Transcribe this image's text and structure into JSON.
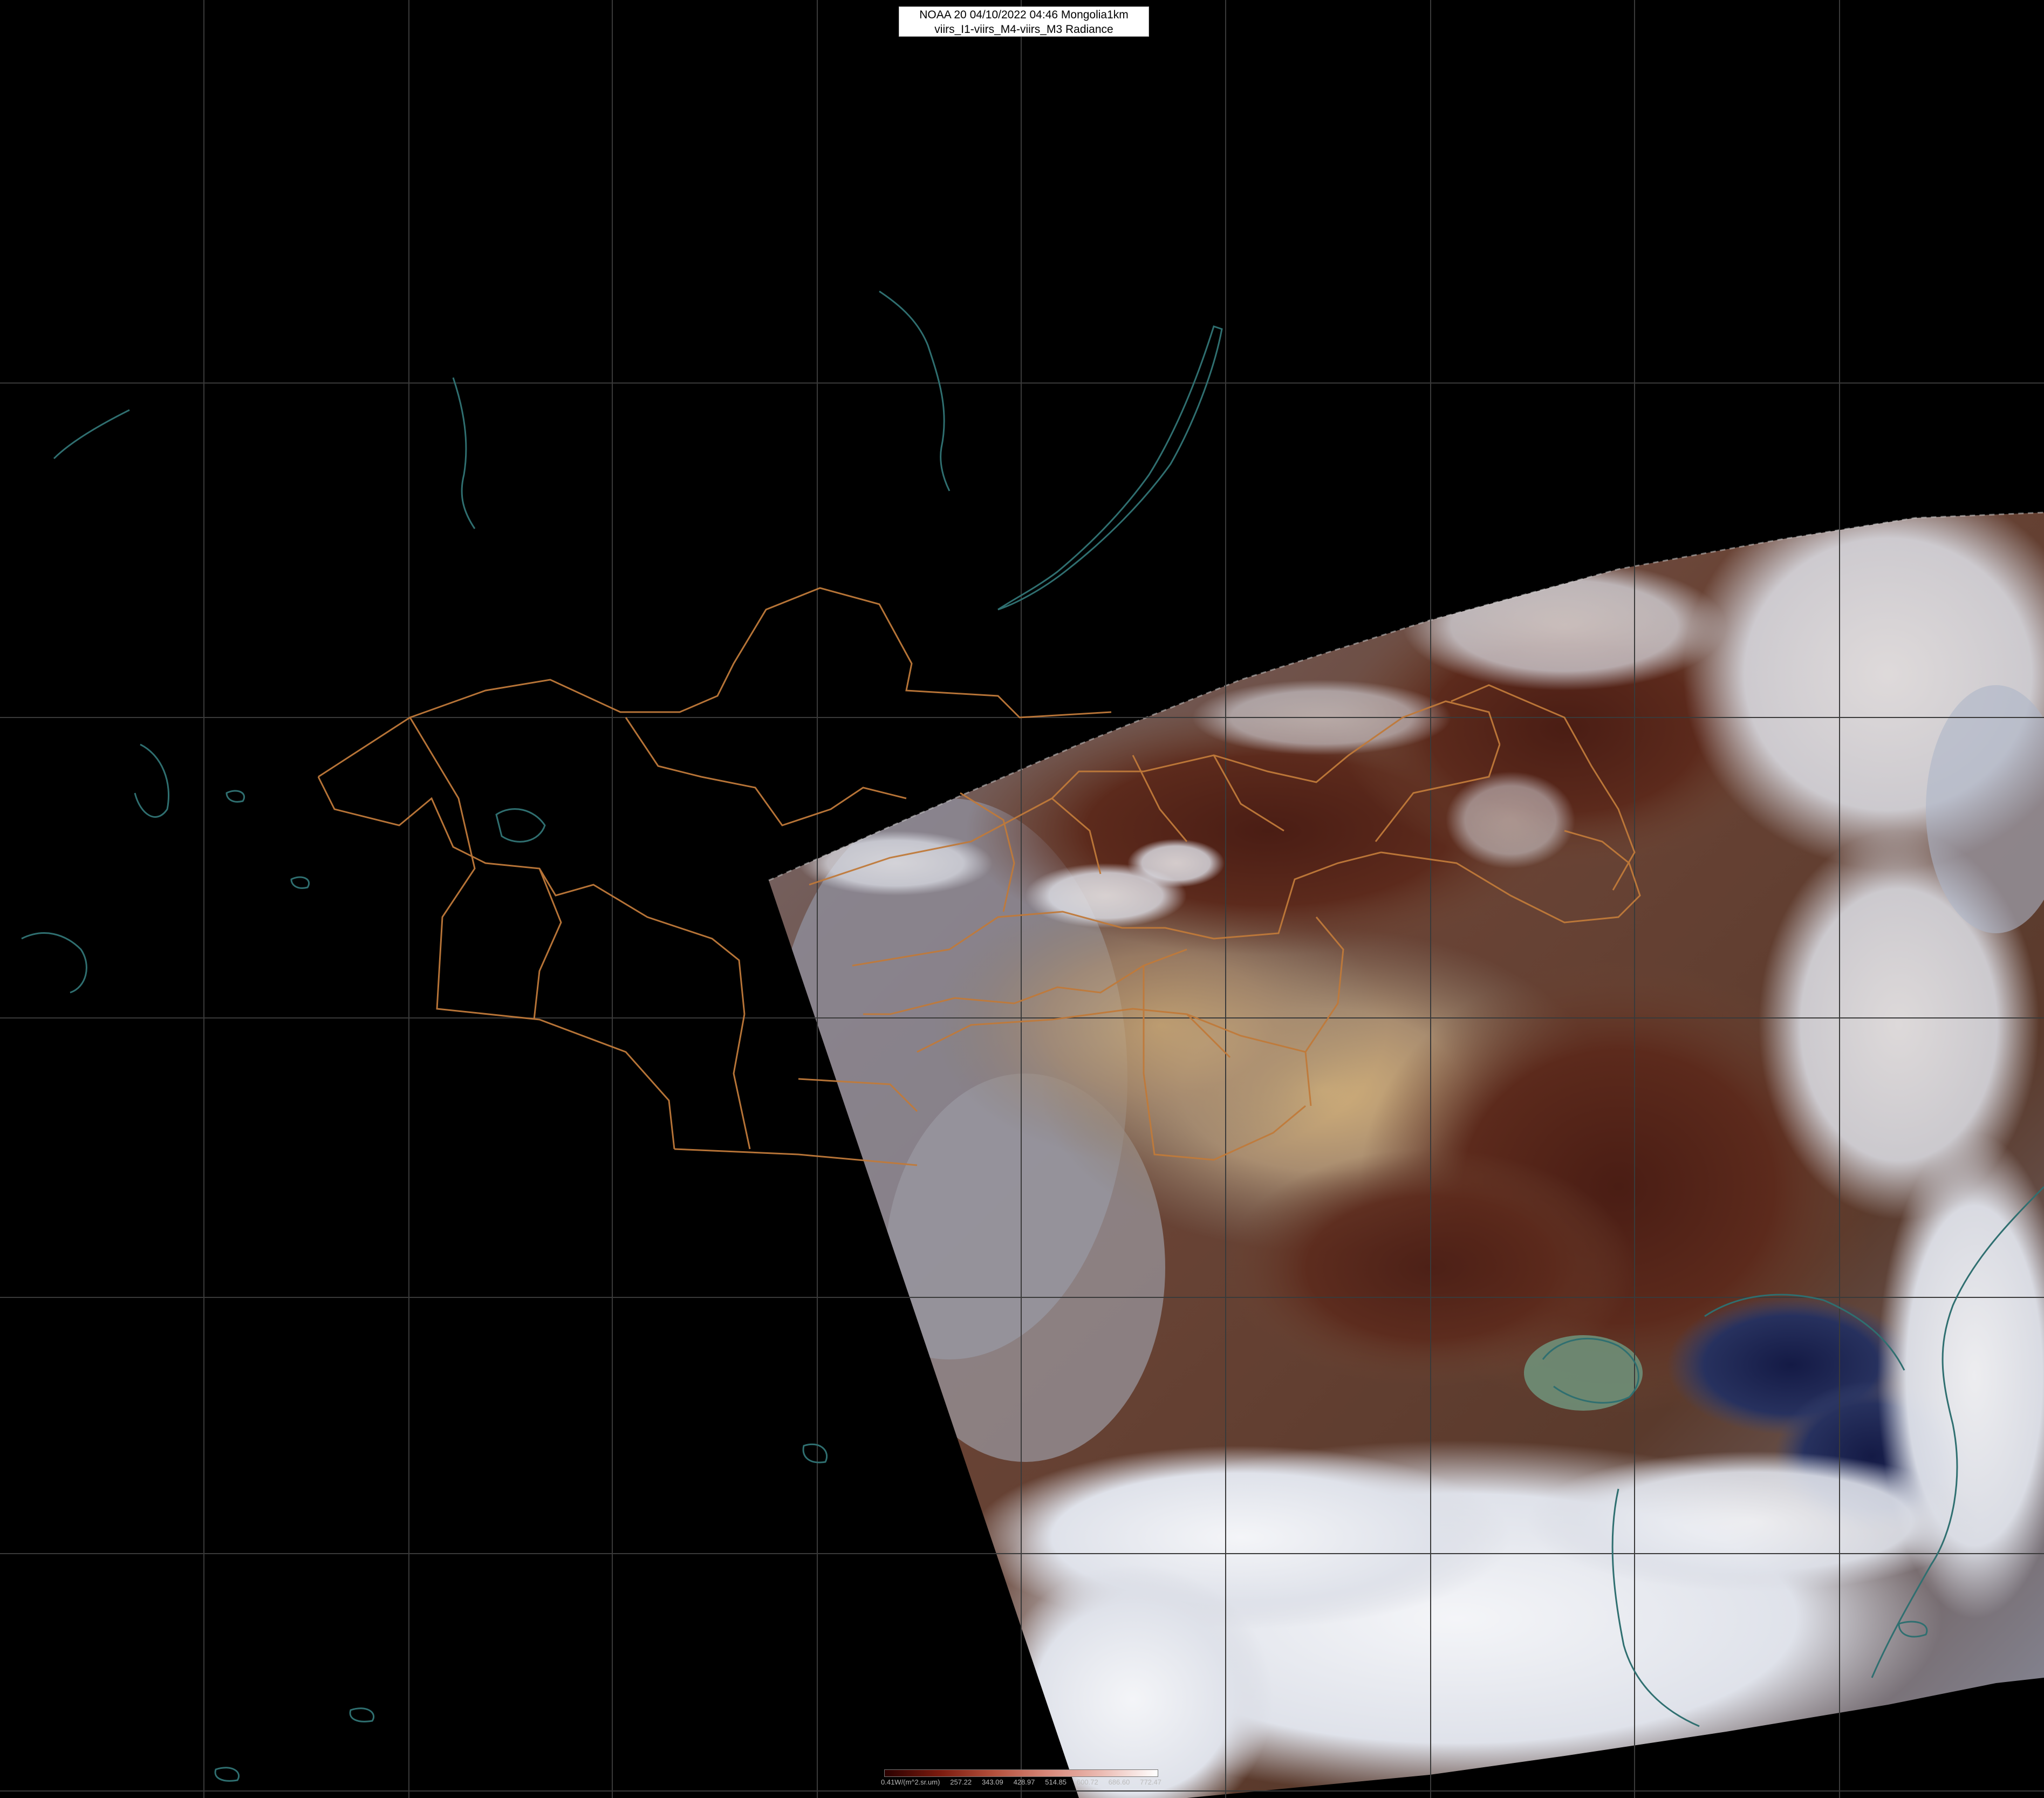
{
  "header": {
    "line1": "NOAA 20 04/10/2022 04:46 Mongolia1km",
    "line2": "viirs_I1-viirs_M4-viirs_M3 Radiance"
  },
  "scene": {
    "description_icon": "satellite-swath-image",
    "colors": {
      "background": "#000000",
      "grid": "#3a3a3a",
      "borders": "#c07a3a",
      "coast": "#2f6f70",
      "cloud": "#eef0f4",
      "soil_dark": "#3a1712",
      "soil_mid": "#7a5238",
      "sea": "#1d2452",
      "bay_water": "#6f8f78"
    }
  },
  "colorbar": {
    "labels": [
      "0.41W/(m^2.sr.um)",
      "257.22",
      "343.09",
      "428.97",
      "514.85",
      "600.72",
      "686.60",
      "772.47"
    ]
  }
}
